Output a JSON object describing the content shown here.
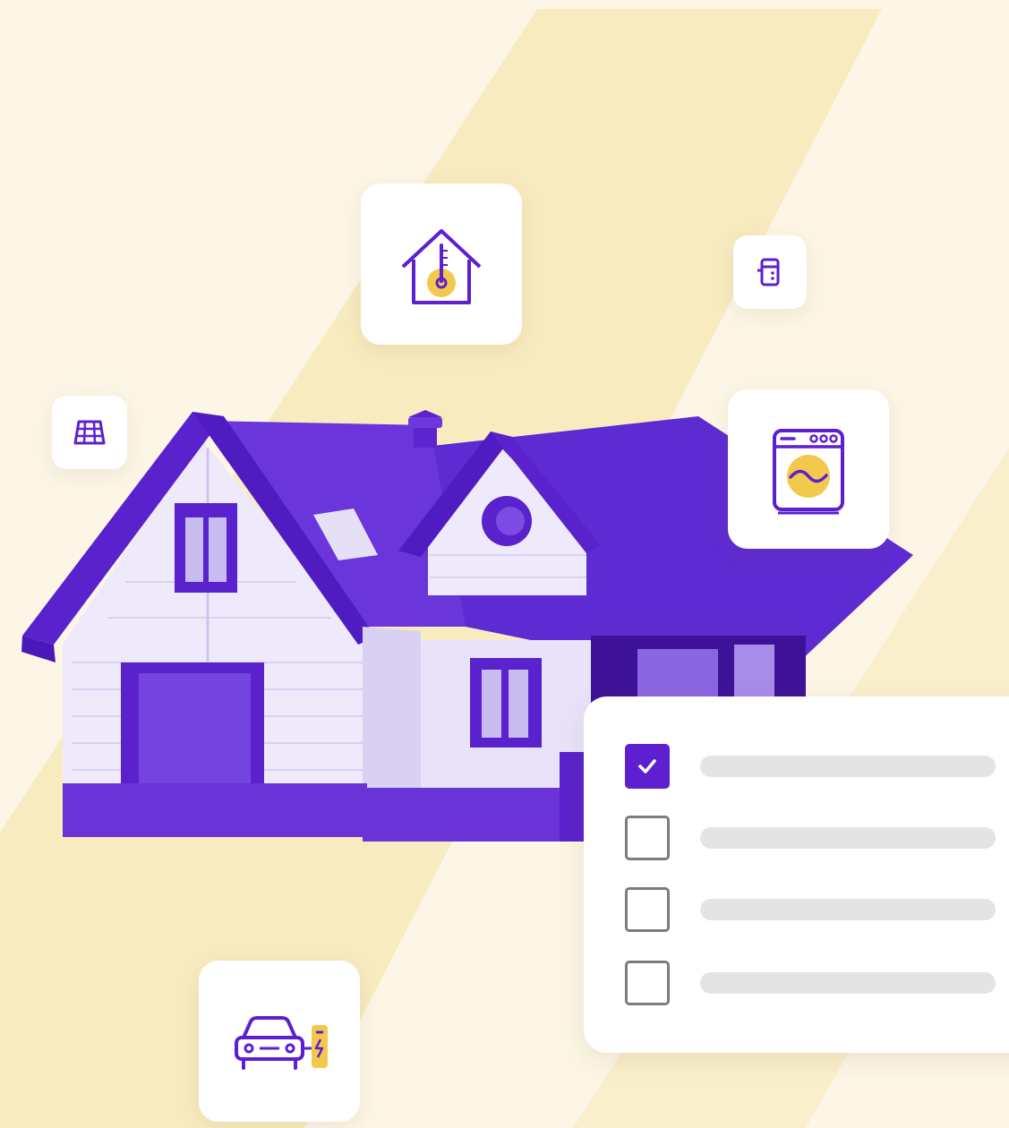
{
  "colors": {
    "background": "#fdf6e6",
    "stripe": "#f7e8b3",
    "brand_purple": "#5d1fcf",
    "accent_yellow": "#f2c94c",
    "placeholder_line": "#e4e4e4"
  },
  "icons": {
    "thermostat": "house-thermometer-icon",
    "battery": "home-battery-icon",
    "solar": "solar-panel-icon",
    "washer": "washing-machine-icon",
    "ev": "electric-car-charger-icon"
  },
  "checklist": {
    "items": [
      {
        "checked": true
      },
      {
        "checked": false
      },
      {
        "checked": false
      },
      {
        "checked": false
      }
    ]
  }
}
